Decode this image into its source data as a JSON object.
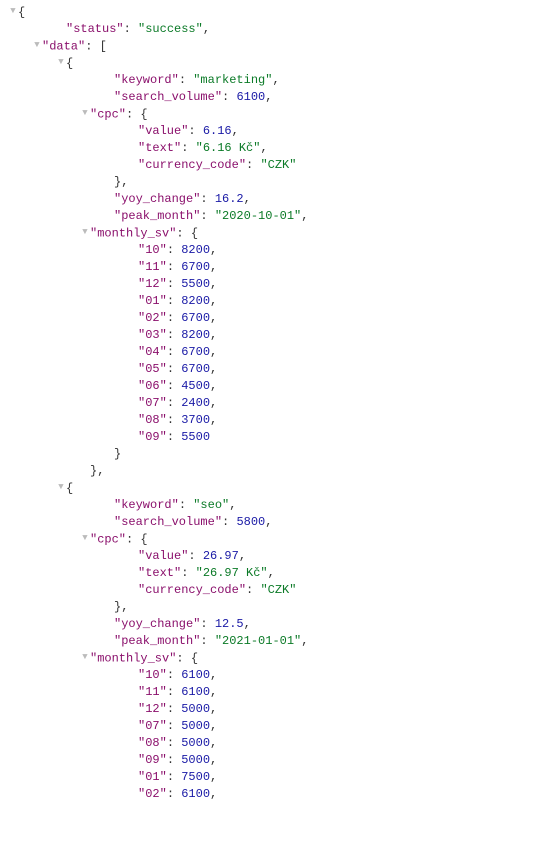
{
  "icons": {
    "caret": "▼"
  },
  "colors": {
    "key": "#8a0f6b",
    "string": "#0b7a27",
    "number": "#1a1aa6",
    "caret": "#bbbbbb"
  },
  "json": {
    "status": "success",
    "data": [
      {
        "keyword": "marketing",
        "search_volume": 6100,
        "cpc": {
          "value": 6.16,
          "text": "6.16 Kč",
          "currency_code": "CZK"
        },
        "yoy_change": 16.2,
        "peak_month": "2020-10-01",
        "monthly_sv": {
          "10": 8200,
          "11": 6700,
          "12": 5500,
          "01": 8200,
          "02": 6700,
          "03": 8200,
          "04": 6700,
          "05": 6700,
          "06": 4500,
          "07": 2400,
          "08": 3700,
          "09": 5500
        }
      },
      {
        "keyword": "seo",
        "search_volume": 5800,
        "cpc": {
          "value": 26.97,
          "text": "26.97 Kč",
          "currency_code": "CZK"
        },
        "yoy_change": 12.5,
        "peak_month": "2021-01-01",
        "monthly_sv": {
          "10": 6100,
          "11": 6100,
          "12": 5000,
          "07": 5000,
          "08": 5000,
          "09": 5000,
          "01": 7500,
          "02": 6100
        }
      }
    ]
  },
  "lines": [
    {
      "depth": 0,
      "toggle": true,
      "tokens": [
        {
          "t": "punc",
          "v": "{"
        }
      ]
    },
    {
      "depth": 2,
      "tokens": [
        {
          "t": "key",
          "v": "\"status\""
        },
        {
          "t": "punc",
          "v": ": "
        },
        {
          "t": "str",
          "v": "\"success\""
        },
        {
          "t": "punc",
          "v": ","
        }
      ]
    },
    {
      "depth": 1,
      "toggle": true,
      "tokens": [
        {
          "t": "key",
          "v": "\"data\""
        },
        {
          "t": "punc",
          "v": ": ["
        }
      ]
    },
    {
      "depth": 2,
      "toggle": true,
      "tokens": [
        {
          "t": "punc",
          "v": "{"
        }
      ]
    },
    {
      "depth": 4,
      "tokens": [
        {
          "t": "key",
          "v": "\"keyword\""
        },
        {
          "t": "punc",
          "v": ": "
        },
        {
          "t": "str",
          "v": "\"marketing\""
        },
        {
          "t": "punc",
          "v": ","
        }
      ]
    },
    {
      "depth": 4,
      "tokens": [
        {
          "t": "key",
          "v": "\"search_volume\""
        },
        {
          "t": "punc",
          "v": ": "
        },
        {
          "t": "num",
          "v": "6100"
        },
        {
          "t": "punc",
          "v": ","
        }
      ]
    },
    {
      "depth": 3,
      "toggle": true,
      "tokens": [
        {
          "t": "key",
          "v": "\"cpc\""
        },
        {
          "t": "punc",
          "v": ": {"
        }
      ]
    },
    {
      "depth": 5,
      "tokens": [
        {
          "t": "key",
          "v": "\"value\""
        },
        {
          "t": "punc",
          "v": ": "
        },
        {
          "t": "num",
          "v": "6.16"
        },
        {
          "t": "punc",
          "v": ","
        }
      ]
    },
    {
      "depth": 5,
      "tokens": [
        {
          "t": "key",
          "v": "\"text\""
        },
        {
          "t": "punc",
          "v": ": "
        },
        {
          "t": "str",
          "v": "\"6.16 Kč\""
        },
        {
          "t": "punc",
          "v": ","
        }
      ]
    },
    {
      "depth": 5,
      "tokens": [
        {
          "t": "key",
          "v": "\"currency_code\""
        },
        {
          "t": "punc",
          "v": ": "
        },
        {
          "t": "str",
          "v": "\"CZK\""
        }
      ]
    },
    {
      "depth": 4,
      "tokens": [
        {
          "t": "punc",
          "v": "},"
        }
      ]
    },
    {
      "depth": 4,
      "tokens": [
        {
          "t": "key",
          "v": "\"yoy_change\""
        },
        {
          "t": "punc",
          "v": ": "
        },
        {
          "t": "num",
          "v": "16.2"
        },
        {
          "t": "punc",
          "v": ","
        }
      ]
    },
    {
      "depth": 4,
      "tokens": [
        {
          "t": "key",
          "v": "\"peak_month\""
        },
        {
          "t": "punc",
          "v": ": "
        },
        {
          "t": "str",
          "v": "\"2020-10-01\""
        },
        {
          "t": "punc",
          "v": ","
        }
      ]
    },
    {
      "depth": 3,
      "toggle": true,
      "tokens": [
        {
          "t": "key",
          "v": "\"monthly_sv\""
        },
        {
          "t": "punc",
          "v": ": {"
        }
      ]
    },
    {
      "depth": 5,
      "tokens": [
        {
          "t": "key",
          "v": "\"10\""
        },
        {
          "t": "punc",
          "v": ": "
        },
        {
          "t": "num",
          "v": "8200"
        },
        {
          "t": "punc",
          "v": ","
        }
      ]
    },
    {
      "depth": 5,
      "tokens": [
        {
          "t": "key",
          "v": "\"11\""
        },
        {
          "t": "punc",
          "v": ": "
        },
        {
          "t": "num",
          "v": "6700"
        },
        {
          "t": "punc",
          "v": ","
        }
      ]
    },
    {
      "depth": 5,
      "tokens": [
        {
          "t": "key",
          "v": "\"12\""
        },
        {
          "t": "punc",
          "v": ": "
        },
        {
          "t": "num",
          "v": "5500"
        },
        {
          "t": "punc",
          "v": ","
        }
      ]
    },
    {
      "depth": 5,
      "tokens": [
        {
          "t": "key",
          "v": "\"01\""
        },
        {
          "t": "punc",
          "v": ": "
        },
        {
          "t": "num",
          "v": "8200"
        },
        {
          "t": "punc",
          "v": ","
        }
      ]
    },
    {
      "depth": 5,
      "tokens": [
        {
          "t": "key",
          "v": "\"02\""
        },
        {
          "t": "punc",
          "v": ": "
        },
        {
          "t": "num",
          "v": "6700"
        },
        {
          "t": "punc",
          "v": ","
        }
      ]
    },
    {
      "depth": 5,
      "tokens": [
        {
          "t": "key",
          "v": "\"03\""
        },
        {
          "t": "punc",
          "v": ": "
        },
        {
          "t": "num",
          "v": "8200"
        },
        {
          "t": "punc",
          "v": ","
        }
      ]
    },
    {
      "depth": 5,
      "tokens": [
        {
          "t": "key",
          "v": "\"04\""
        },
        {
          "t": "punc",
          "v": ": "
        },
        {
          "t": "num",
          "v": "6700"
        },
        {
          "t": "punc",
          "v": ","
        }
      ]
    },
    {
      "depth": 5,
      "tokens": [
        {
          "t": "key",
          "v": "\"05\""
        },
        {
          "t": "punc",
          "v": ": "
        },
        {
          "t": "num",
          "v": "6700"
        },
        {
          "t": "punc",
          "v": ","
        }
      ]
    },
    {
      "depth": 5,
      "tokens": [
        {
          "t": "key",
          "v": "\"06\""
        },
        {
          "t": "punc",
          "v": ": "
        },
        {
          "t": "num",
          "v": "4500"
        },
        {
          "t": "punc",
          "v": ","
        }
      ]
    },
    {
      "depth": 5,
      "tokens": [
        {
          "t": "key",
          "v": "\"07\""
        },
        {
          "t": "punc",
          "v": ": "
        },
        {
          "t": "num",
          "v": "2400"
        },
        {
          "t": "punc",
          "v": ","
        }
      ]
    },
    {
      "depth": 5,
      "tokens": [
        {
          "t": "key",
          "v": "\"08\""
        },
        {
          "t": "punc",
          "v": ": "
        },
        {
          "t": "num",
          "v": "3700"
        },
        {
          "t": "punc",
          "v": ","
        }
      ]
    },
    {
      "depth": 5,
      "tokens": [
        {
          "t": "key",
          "v": "\"09\""
        },
        {
          "t": "punc",
          "v": ": "
        },
        {
          "t": "num",
          "v": "5500"
        }
      ]
    },
    {
      "depth": 4,
      "tokens": [
        {
          "t": "punc",
          "v": "}"
        }
      ]
    },
    {
      "depth": 3,
      "tokens": [
        {
          "t": "punc",
          "v": "},"
        }
      ]
    },
    {
      "depth": 2,
      "toggle": true,
      "tokens": [
        {
          "t": "punc",
          "v": "{"
        }
      ]
    },
    {
      "depth": 4,
      "tokens": [
        {
          "t": "key",
          "v": "\"keyword\""
        },
        {
          "t": "punc",
          "v": ": "
        },
        {
          "t": "str",
          "v": "\"seo\""
        },
        {
          "t": "punc",
          "v": ","
        }
      ]
    },
    {
      "depth": 4,
      "tokens": [
        {
          "t": "key",
          "v": "\"search_volume\""
        },
        {
          "t": "punc",
          "v": ": "
        },
        {
          "t": "num",
          "v": "5800"
        },
        {
          "t": "punc",
          "v": ","
        }
      ]
    },
    {
      "depth": 3,
      "toggle": true,
      "tokens": [
        {
          "t": "key",
          "v": "\"cpc\""
        },
        {
          "t": "punc",
          "v": ": {"
        }
      ]
    },
    {
      "depth": 5,
      "tokens": [
        {
          "t": "key",
          "v": "\"value\""
        },
        {
          "t": "punc",
          "v": ": "
        },
        {
          "t": "num",
          "v": "26.97"
        },
        {
          "t": "punc",
          "v": ","
        }
      ]
    },
    {
      "depth": 5,
      "tokens": [
        {
          "t": "key",
          "v": "\"text\""
        },
        {
          "t": "punc",
          "v": ": "
        },
        {
          "t": "str",
          "v": "\"26.97 Kč\""
        },
        {
          "t": "punc",
          "v": ","
        }
      ]
    },
    {
      "depth": 5,
      "tokens": [
        {
          "t": "key",
          "v": "\"currency_code\""
        },
        {
          "t": "punc",
          "v": ": "
        },
        {
          "t": "str",
          "v": "\"CZK\""
        }
      ]
    },
    {
      "depth": 4,
      "tokens": [
        {
          "t": "punc",
          "v": "},"
        }
      ]
    },
    {
      "depth": 4,
      "tokens": [
        {
          "t": "key",
          "v": "\"yoy_change\""
        },
        {
          "t": "punc",
          "v": ": "
        },
        {
          "t": "num",
          "v": "12.5"
        },
        {
          "t": "punc",
          "v": ","
        }
      ]
    },
    {
      "depth": 4,
      "tokens": [
        {
          "t": "key",
          "v": "\"peak_month\""
        },
        {
          "t": "punc",
          "v": ": "
        },
        {
          "t": "str",
          "v": "\"2021-01-01\""
        },
        {
          "t": "punc",
          "v": ","
        }
      ]
    },
    {
      "depth": 3,
      "toggle": true,
      "tokens": [
        {
          "t": "key",
          "v": "\"monthly_sv\""
        },
        {
          "t": "punc",
          "v": ": {"
        }
      ]
    },
    {
      "depth": 5,
      "tokens": [
        {
          "t": "key",
          "v": "\"10\""
        },
        {
          "t": "punc",
          "v": ": "
        },
        {
          "t": "num",
          "v": "6100"
        },
        {
          "t": "punc",
          "v": ","
        }
      ]
    },
    {
      "depth": 5,
      "tokens": [
        {
          "t": "key",
          "v": "\"11\""
        },
        {
          "t": "punc",
          "v": ": "
        },
        {
          "t": "num",
          "v": "6100"
        },
        {
          "t": "punc",
          "v": ","
        }
      ]
    },
    {
      "depth": 5,
      "tokens": [
        {
          "t": "key",
          "v": "\"12\""
        },
        {
          "t": "punc",
          "v": ": "
        },
        {
          "t": "num",
          "v": "5000"
        },
        {
          "t": "punc",
          "v": ","
        }
      ]
    },
    {
      "depth": 5,
      "tokens": [
        {
          "t": "key",
          "v": "\"07\""
        },
        {
          "t": "punc",
          "v": ": "
        },
        {
          "t": "num",
          "v": "5000"
        },
        {
          "t": "punc",
          "v": ","
        }
      ]
    },
    {
      "depth": 5,
      "tokens": [
        {
          "t": "key",
          "v": "\"08\""
        },
        {
          "t": "punc",
          "v": ": "
        },
        {
          "t": "num",
          "v": "5000"
        },
        {
          "t": "punc",
          "v": ","
        }
      ]
    },
    {
      "depth": 5,
      "tokens": [
        {
          "t": "key",
          "v": "\"09\""
        },
        {
          "t": "punc",
          "v": ": "
        },
        {
          "t": "num",
          "v": "5000"
        },
        {
          "t": "punc",
          "v": ","
        }
      ]
    },
    {
      "depth": 5,
      "tokens": [
        {
          "t": "key",
          "v": "\"01\""
        },
        {
          "t": "punc",
          "v": ": "
        },
        {
          "t": "num",
          "v": "7500"
        },
        {
          "t": "punc",
          "v": ","
        }
      ]
    },
    {
      "depth": 5,
      "tokens": [
        {
          "t": "key",
          "v": "\"02\""
        },
        {
          "t": "punc",
          "v": ": "
        },
        {
          "t": "num",
          "v": "6100"
        },
        {
          "t": "punc",
          "v": ","
        }
      ]
    }
  ]
}
